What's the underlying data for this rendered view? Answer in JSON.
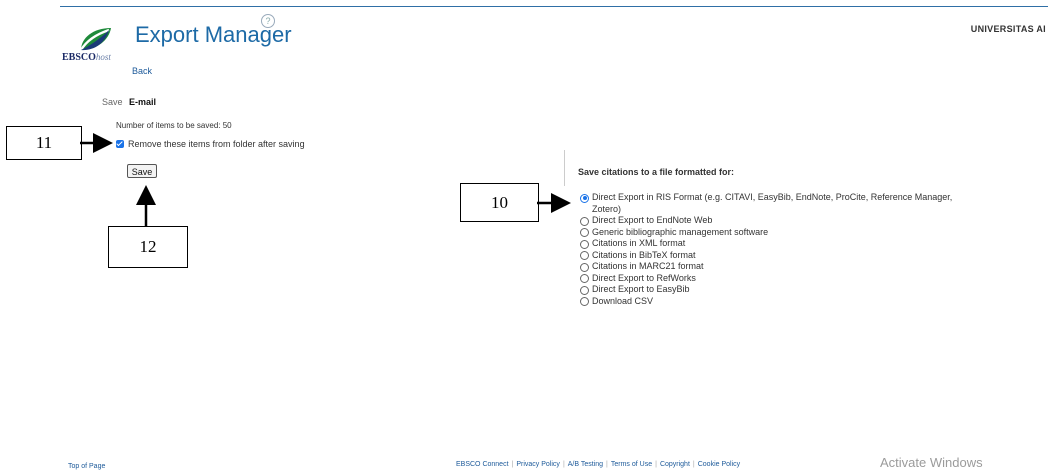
{
  "header": {
    "brand_name": "EBSCO",
    "brand_suffix": "host",
    "title": "Export Manager",
    "help_glyph": "?",
    "institution": "UNIVERSITAS AI",
    "back_label": "Back",
    "accent_color": "#1d6aa6"
  },
  "tabs": {
    "save": "Save",
    "email": "E-mail"
  },
  "save_panel": {
    "count_text": "Number of items to be saved: 50",
    "remove_label": "Remove these items from folder after saving",
    "remove_checked": true,
    "save_button": "Save"
  },
  "format_panel": {
    "heading": "Save citations to a file formatted for:",
    "options": [
      {
        "label": "Direct Export in RIS Format (e.g. CITAVI, EasyBib, EndNote, ProCite, Reference Manager, Zotero)",
        "selected": true
      },
      {
        "label": "Direct Export to EndNote Web",
        "selected": false
      },
      {
        "label": "Generic bibliographic management software",
        "selected": false
      },
      {
        "label": "Citations in XML format",
        "selected": false
      },
      {
        "label": "Citations in BibTeX format",
        "selected": false
      },
      {
        "label": "Citations in MARC21 format",
        "selected": false
      },
      {
        "label": "Direct Export to RefWorks",
        "selected": false
      },
      {
        "label": "Direct Export to EasyBib",
        "selected": false
      },
      {
        "label": "Download CSV",
        "selected": false
      }
    ]
  },
  "callouts": {
    "c10": "10",
    "c11": "11",
    "c12": "12"
  },
  "footer": {
    "top_of_page": "Top of Page",
    "links": [
      "EBSCO Connect",
      "Privacy Policy",
      "A/B Testing",
      "Terms of Use",
      "Copyright",
      "Cookie Policy"
    ]
  },
  "watermark": "Activate Windows"
}
